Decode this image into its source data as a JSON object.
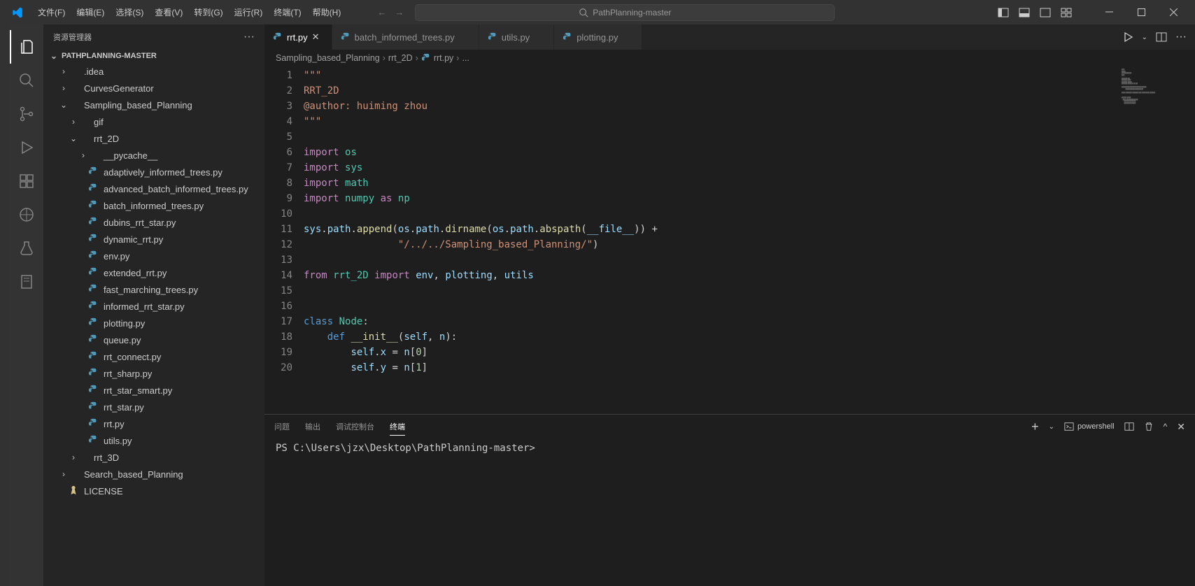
{
  "menu": [
    "文件(F)",
    "编辑(E)",
    "选择(S)",
    "查看(V)",
    "转到(G)",
    "运行(R)",
    "终端(T)",
    "帮助(H)"
  ],
  "search_placeholder": "PathPlanning-master",
  "explorer_title": "资源管理器",
  "project_name": "PATHPLANNING-MASTER",
  "tree": {
    "folders_l1": [
      {
        "name": ".idea",
        "open": false,
        "indent": 1
      },
      {
        "name": "CurvesGenerator",
        "open": false,
        "indent": 1
      },
      {
        "name": "Sampling_based_Planning",
        "open": true,
        "indent": 1
      },
      {
        "name": "gif",
        "open": false,
        "indent": 2
      },
      {
        "name": "rrt_2D",
        "open": true,
        "indent": 2
      },
      {
        "name": "__pycache__",
        "open": false,
        "indent": 3
      }
    ],
    "files_rrt2d": [
      "adaptively_informed_trees.py",
      "advanced_batch_informed_trees.py",
      "batch_informed_trees.py",
      "dubins_rrt_star.py",
      "dynamic_rrt.py",
      "env.py",
      "extended_rrt.py",
      "fast_marching_trees.py",
      "informed_rrt_star.py",
      "plotting.py",
      "queue.py",
      "rrt_connect.py",
      "rrt_sharp.py",
      "rrt_star_smart.py",
      "rrt_star.py",
      "rrt.py",
      "utils.py"
    ],
    "post_folders": [
      {
        "name": "rrt_3D",
        "open": false,
        "indent": 2
      },
      {
        "name": "Search_based_Planning",
        "open": false,
        "indent": 1
      }
    ],
    "license": "LICENSE"
  },
  "tabs": [
    {
      "label": "rrt.py",
      "active": true
    },
    {
      "label": "batch_informed_trees.py",
      "active": false
    },
    {
      "label": "utils.py",
      "active": false
    },
    {
      "label": "plotting.py",
      "active": false
    }
  ],
  "breadcrumb": [
    "Sampling_based_Planning",
    "rrt_2D",
    "rrt.py",
    "..."
  ],
  "lines": [
    "1",
    "2",
    "3",
    "4",
    "5",
    "6",
    "7",
    "8",
    "9",
    "10",
    "11",
    "12",
    "13",
    "14",
    "15",
    "16",
    "17",
    "18",
    "19",
    "20"
  ],
  "panel": {
    "tabs": [
      "问题",
      "输出",
      "调试控制台",
      "终端"
    ],
    "active": 3,
    "shell": "powershell",
    "prompt": "PS C:\\Users\\jzx\\Desktop\\PathPlanning-master> "
  },
  "code_text": {
    "l1": "\"\"\"",
    "l2": "RRT_2D",
    "l3": "@author: huiming zhou",
    "l4": "\"\"\"",
    "l6a": "import",
    "l6b": "os",
    "l7a": "import",
    "l7b": "sys",
    "l8a": "import",
    "l8b": "math",
    "l9a": "import",
    "l9b": "numpy",
    "l9c": "as",
    "l9d": "np",
    "l11_sys": "sys",
    "l11_path": "path",
    "l11_append": "append",
    "l11_os": "os",
    "l11_dirname": "dirname",
    "l11_abspath": "abspath",
    "l11_file": "__file__",
    "l11_plus": " +",
    "l12_str": "\"/../../Sampling_based_Planning/\"",
    "l14a": "from",
    "l14b": "rrt_2D",
    "l14c": "import",
    "l14d": "env",
    "l14e": "plotting",
    "l14f": "utils",
    "l17a": "class",
    "l17b": "Node",
    "l18a": "def",
    "l18b": "__init__",
    "l18c": "self",
    "l18d": "n",
    "l19a": "self",
    "l19b": "x",
    "l19c": "n",
    "l19d": "0",
    "l20a": "self",
    "l20b": "y",
    "l20c": "n",
    "l20d": "1"
  }
}
